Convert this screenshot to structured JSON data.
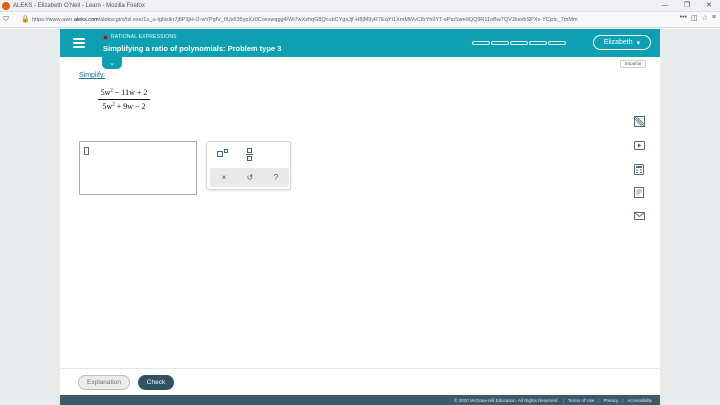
{
  "browser": {
    "tab_title": "ALEKS - Elizabeth O'Neil - Learn - Mozilla Firefox",
    "window_controls": [
      "—",
      "❐",
      "✕"
    ],
    "url_prefix": "https://www-awn.",
    "url_domain": "aleks.com",
    "url_rest": "/alekscgi/x/Isl.exe/1o_u-IgNslkr7j8P3jH-lJ-wYPgfV_IlUx635ypXz0Coxvwqgg4/Wi7wXzhqG8QcubCYgsJjf-H8jM9yR7EqYt1XmMWvC8rYh9YT-sPtoSwe9QQ9R11oBw7QVJbavbSPXx-YCjzlc_7mMm"
  },
  "header": {
    "topic": "RATIONAL EXPRESSIONS",
    "problem_title": "Simplifying a ratio of polynomials: Problem type 3",
    "user_name": "Elizabeth",
    "accent_color": "#0f9fb2"
  },
  "language_button": "Español",
  "question": {
    "instruction": "Simplify.",
    "numerator": {
      "coef": "5w",
      "exp": "2",
      "rest": " − 11w + 2"
    },
    "denominator": {
      "coef": "5w",
      "exp": "2",
      "rest": " + 9w − 2"
    }
  },
  "palette": {
    "row1_icons": [
      "exponent-icon",
      "fraction-icon"
    ],
    "row2": {
      "clear": "×",
      "undo": "↺",
      "help": "?"
    }
  },
  "tools": [
    "calculator-grid-icon",
    "video-icon",
    "calculator-icon",
    "textbook-icon",
    "mail-icon"
  ],
  "footer": {
    "explanation_label": "Explanation",
    "check_label": "Check",
    "copyright": "© 2020 McGraw-Hill Education. All Rights Reserved.",
    "terms": "Terms of Use",
    "privacy": "Privacy",
    "accessibility": "Accessibility"
  }
}
